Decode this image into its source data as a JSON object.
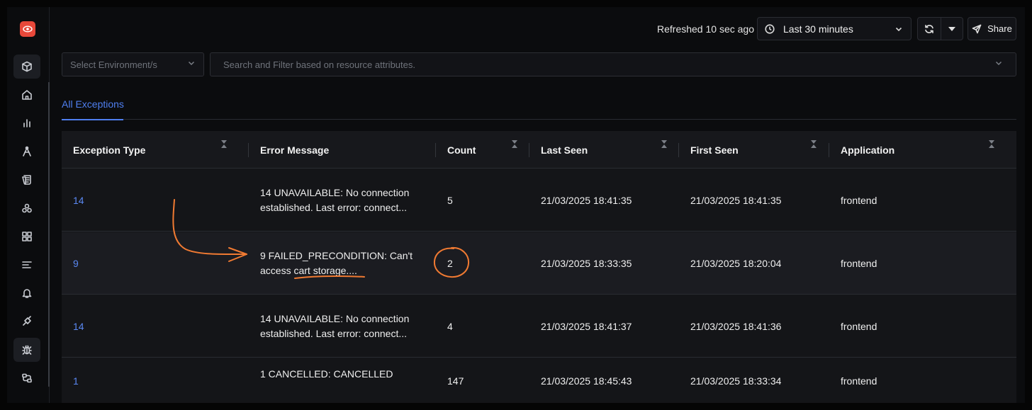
{
  "header": {
    "refreshed_text": "Refreshed 10 sec ago",
    "time_range": "Last 30 minutes",
    "share_label": "Share"
  },
  "filters": {
    "environment_placeholder": "Select Environment/s",
    "search_placeholder": "Search and Filter based on resource attributes."
  },
  "tabs": [
    {
      "label": "All Exceptions",
      "active": true
    }
  ],
  "table": {
    "columns": [
      "Exception Type",
      "Error Message",
      "Count",
      "Last Seen",
      "First Seen",
      "Application"
    ],
    "rows": [
      {
        "exception_type": "14",
        "error_line1": "14 UNAVAILABLE: No connection",
        "error_line2": "established. Last error: connect...",
        "count": "5",
        "last_seen": "21/03/2025 18:41:35",
        "first_seen": "21/03/2025 18:41:35",
        "application": "frontend"
      },
      {
        "exception_type": "9",
        "error_line1": "9 FAILED_PRECONDITION: Can't",
        "error_line2": "access cart storage....",
        "count": "2",
        "last_seen": "21/03/2025 18:33:35",
        "first_seen": "21/03/2025 18:20:04",
        "application": "frontend"
      },
      {
        "exception_type": "14",
        "error_line1": "14 UNAVAILABLE: No connection",
        "error_line2": "established. Last error: connect...",
        "count": "4",
        "last_seen": "21/03/2025 18:41:37",
        "first_seen": "21/03/2025 18:41:36",
        "application": "frontend"
      },
      {
        "exception_type": "1",
        "error_line1": "1 CANCELLED: CANCELLED",
        "error_line2": "",
        "count": "147",
        "last_seen": "21/03/2025 18:45:43",
        "first_seen": "21/03/2025 18:33:34",
        "application": "frontend"
      }
    ]
  },
  "colors": {
    "accent": "#4f7ff0",
    "annotation": "#f07a32",
    "logo": "#e8483a"
  },
  "sidebar": {
    "icons": [
      "cube-icon",
      "home-icon",
      "bar-chart-icon",
      "traces-icon",
      "logs-icon",
      "services-icon",
      "dashboard-icon",
      "list-icon",
      "alerts-icon",
      "integrations-icon",
      "bug-icon",
      "pipelines-icon"
    ]
  }
}
